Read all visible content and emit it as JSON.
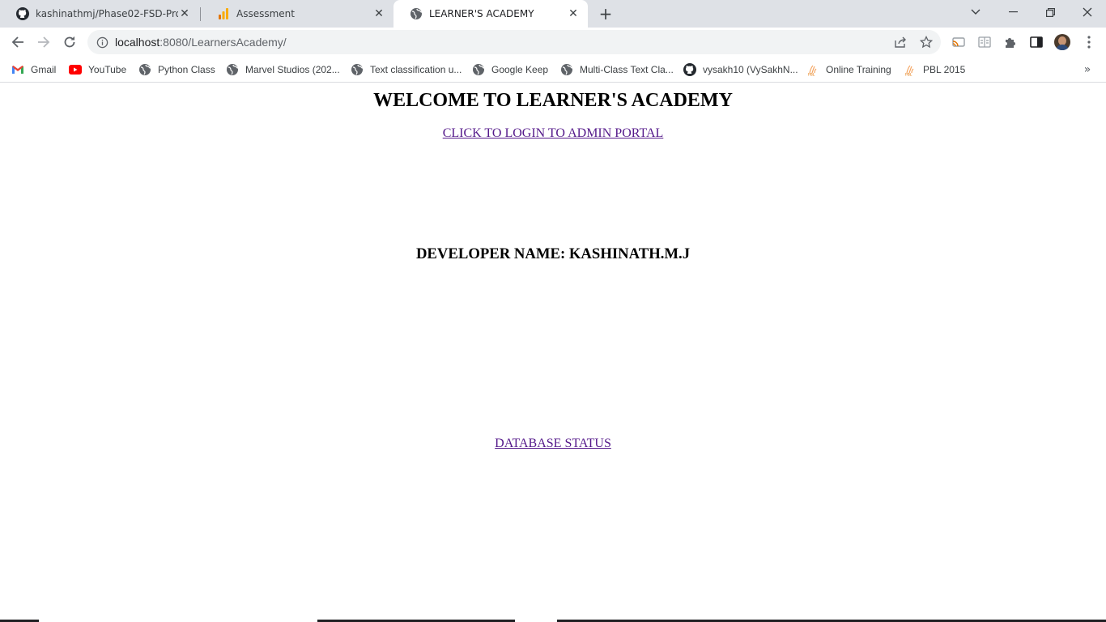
{
  "browser": {
    "tabs": [
      {
        "title": "kashinathmj/Phase02-FSD-Projec",
        "icon": "github-icon",
        "active": false
      },
      {
        "title": "Assessment",
        "icon": "analytics-icon",
        "active": false
      },
      {
        "title": "LEARNER'S ACADEMY",
        "icon": "globe-icon",
        "active": true
      }
    ],
    "new_tab_label": "+",
    "address": {
      "host": "localhost",
      "rest": ":8080/LearnersAcademy/"
    },
    "bookmarks": [
      {
        "label": "Gmail",
        "icon": "gmail-icon"
      },
      {
        "label": "YouTube",
        "icon": "youtube-icon"
      },
      {
        "label": "Python Class",
        "icon": "globe-icon"
      },
      {
        "label": "Marvel Studios (202...",
        "icon": "globe-icon"
      },
      {
        "label": "Text classification u...",
        "icon": "globe-icon"
      },
      {
        "label": "Google Keep",
        "icon": "globe-icon"
      },
      {
        "label": "Multi-Class Text Cla...",
        "icon": "globe-icon"
      },
      {
        "label": "vysakh10 (VySakhN...",
        "icon": "github-icon"
      },
      {
        "label": "Online Training",
        "icon": "pbl-icon"
      },
      {
        "label": "PBL 2015",
        "icon": "pbl-icon"
      }
    ],
    "colors": {
      "tabstrip": "#dee1e6",
      "omnibox": "#f1f3f4",
      "link": "#551a8b"
    }
  },
  "page": {
    "heading": "WELCOME TO LEARNER'S ACADEMY",
    "login_link": "CLICK TO LOGIN TO ADMIN PORTAL",
    "developer": "DEVELOPER NAME: KASHINATH.M.J",
    "database_link": "DATABASE STATUS"
  }
}
